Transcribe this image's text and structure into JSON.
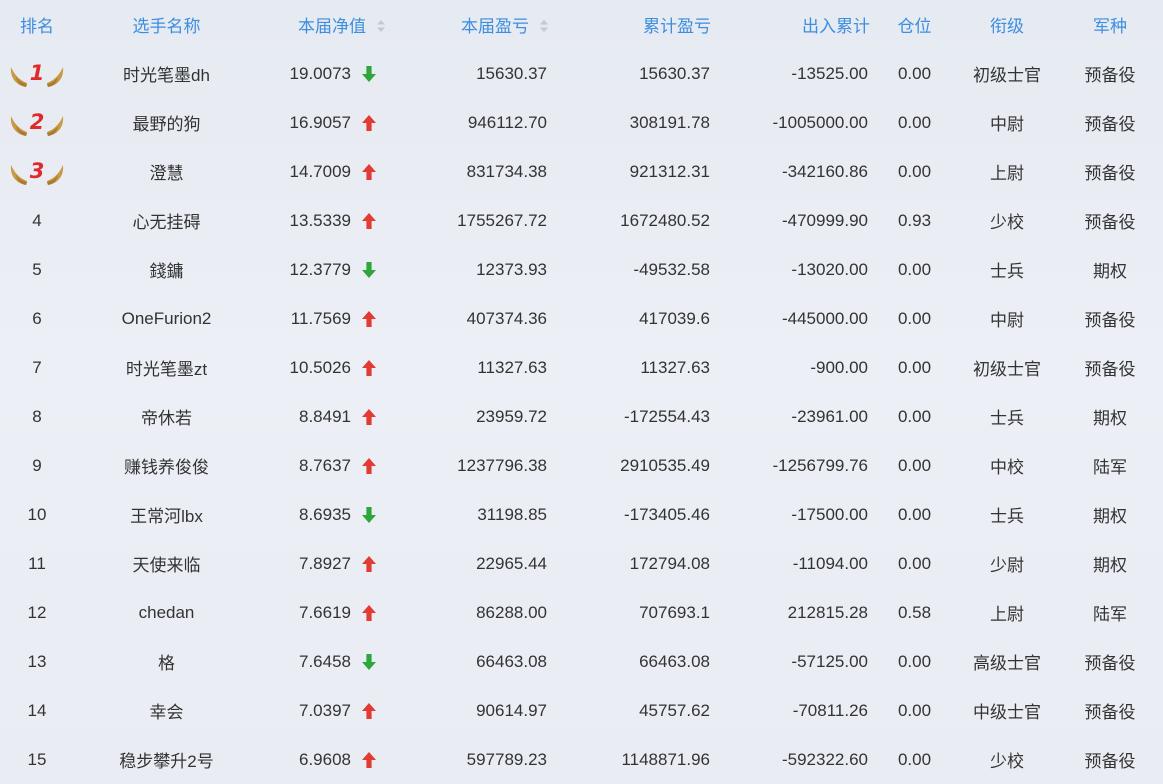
{
  "columns": {
    "rank": "排名",
    "name": "选手名称",
    "nav": "本届净值",
    "profit": "本届盈亏",
    "total_profit": "累计盈亏",
    "flow": "出入累计",
    "position": "仓位",
    "title": "衔级",
    "branch": "军种"
  },
  "sortable_columns": [
    "nav",
    "profit"
  ],
  "colors": {
    "header_text": "#3d8ee0",
    "up_arrow": "#e23b33",
    "down_arrow": "#2ea63a",
    "medal_digit": "#e02a2a",
    "wing": "#c99a45"
  },
  "rows": [
    {
      "rank": "1",
      "medal": true,
      "name": "时光笔墨dh",
      "nav": "19.0073",
      "trend": "down",
      "profit": "15630.37",
      "total_profit": "15630.37",
      "flow": "-13525.00",
      "position": "0.00",
      "title": "初级士官",
      "branch": "预备役"
    },
    {
      "rank": "2",
      "medal": true,
      "name": "最野的狗",
      "nav": "16.9057",
      "trend": "up",
      "profit": "946112.70",
      "total_profit": "308191.78",
      "flow": "-1005000.00",
      "position": "0.00",
      "title": "中尉",
      "branch": "预备役"
    },
    {
      "rank": "3",
      "medal": true,
      "name": "澄慧",
      "nav": "14.7009",
      "trend": "up",
      "profit": "831734.38",
      "total_profit": "921312.31",
      "flow": "-342160.86",
      "position": "0.00",
      "title": "上尉",
      "branch": "预备役"
    },
    {
      "rank": "4",
      "medal": false,
      "name": "心无挂碍",
      "nav": "13.5339",
      "trend": "up",
      "profit": "1755267.72",
      "total_profit": "1672480.52",
      "flow": "-470999.90",
      "position": "0.93",
      "title": "少校",
      "branch": "预备役"
    },
    {
      "rank": "5",
      "medal": false,
      "name": "錢鏞",
      "nav": "12.3779",
      "trend": "down",
      "profit": "12373.93",
      "total_profit": "-49532.58",
      "flow": "-13020.00",
      "position": "0.00",
      "title": "士兵",
      "branch": "期权"
    },
    {
      "rank": "6",
      "medal": false,
      "name": "OneFurion2",
      "nav": "11.7569",
      "trend": "up",
      "profit": "407374.36",
      "total_profit": "417039.6",
      "flow": "-445000.00",
      "position": "0.00",
      "title": "中尉",
      "branch": "预备役"
    },
    {
      "rank": "7",
      "medal": false,
      "name": "时光笔墨zt",
      "nav": "10.5026",
      "trend": "up",
      "profit": "11327.63",
      "total_profit": "11327.63",
      "flow": "-900.00",
      "position": "0.00",
      "title": "初级士官",
      "branch": "预备役"
    },
    {
      "rank": "8",
      "medal": false,
      "name": "帝休若",
      "nav": "8.8491",
      "trend": "up",
      "profit": "23959.72",
      "total_profit": "-172554.43",
      "flow": "-23961.00",
      "position": "0.00",
      "title": "士兵",
      "branch": "期权"
    },
    {
      "rank": "9",
      "medal": false,
      "name": "赚钱养俊俊",
      "nav": "8.7637",
      "trend": "up",
      "profit": "1237796.38",
      "total_profit": "2910535.49",
      "flow": "-1256799.76",
      "position": "0.00",
      "title": "中校",
      "branch": "陆军"
    },
    {
      "rank": "10",
      "medal": false,
      "name": "王常河lbx",
      "nav": "8.6935",
      "trend": "down",
      "profit": "31198.85",
      "total_profit": "-173405.46",
      "flow": "-17500.00",
      "position": "0.00",
      "title": "士兵",
      "branch": "期权"
    },
    {
      "rank": "11",
      "medal": false,
      "name": "天使来临",
      "nav": "7.8927",
      "trend": "up",
      "profit": "22965.44",
      "total_profit": "172794.08",
      "flow": "-11094.00",
      "position": "0.00",
      "title": "少尉",
      "branch": "期权"
    },
    {
      "rank": "12",
      "medal": false,
      "name": "chedan",
      "nav": "7.6619",
      "trend": "up",
      "profit": "86288.00",
      "total_profit": "707693.1",
      "flow": "212815.28",
      "position": "0.58",
      "title": "上尉",
      "branch": "陆军"
    },
    {
      "rank": "13",
      "medal": false,
      "name": "格",
      "nav": "7.6458",
      "trend": "down",
      "profit": "66463.08",
      "total_profit": "66463.08",
      "flow": "-57125.00",
      "position": "0.00",
      "title": "高级士官",
      "branch": "预备役"
    },
    {
      "rank": "14",
      "medal": false,
      "name": "幸会",
      "nav": "7.0397",
      "trend": "up",
      "profit": "90614.97",
      "total_profit": "45757.62",
      "flow": "-70811.26",
      "position": "0.00",
      "title": "中级士官",
      "branch": "预备役"
    },
    {
      "rank": "15",
      "medal": false,
      "name": "稳步攀升2号",
      "nav": "6.9608",
      "trend": "up",
      "profit": "597789.23",
      "total_profit": "1148871.96",
      "flow": "-592322.60",
      "position": "0.00",
      "title": "少校",
      "branch": "预备役"
    }
  ]
}
